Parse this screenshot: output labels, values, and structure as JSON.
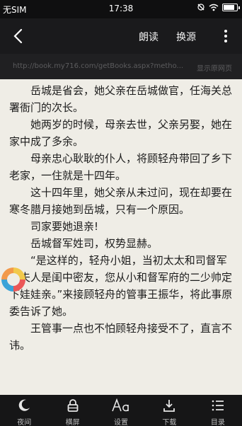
{
  "status_bar": {
    "carrier": "无SIM",
    "time": "17:38",
    "battery_level": 0.85
  },
  "toolbar": {
    "read_aloud": "朗读",
    "change_source": "换源"
  },
  "url_bar": {
    "url": "http://book.my716.com/getBooks.aspx?metho...",
    "show_web": "显示原网页"
  },
  "content": {
    "paragraphs": [
      "岳城是省会，她父亲在岳城做官，任海关总署衙门的次长。",
      "她两岁的时候，母亲去世，父亲另娶，她在家中成了多余。",
      "母亲忠心耿耿的仆人，将顾轻舟带回了乡下老家，一住就是十四年。",
      "这十四年里，她父亲从未过问，现在却要在寒冬腊月接她到岳城，只有一个原因。",
      "司家要她退亲!",
      "岳城督军姓司，权势显赫。",
      "“是这样的，轻舟小姐，当初太太和司督军的夫人是闺中密友，您从小和督军府的二少帅定下娃娃亲。”来接顾轻舟的管事王振华，将此事原委告诉了她。",
      "王管事一点也不怕顾轻舟接受不了，直言不讳。"
    ]
  },
  "bottom_bar": {
    "night": "夜间",
    "lock_screen": "横屏",
    "settings": "设置",
    "download": "下载",
    "catalog": "目录"
  },
  "icons": {
    "night": "moon-icon",
    "lock": "lock-icon",
    "settings": "font-settings-icon",
    "download": "download-icon",
    "catalog": "list-icon"
  }
}
